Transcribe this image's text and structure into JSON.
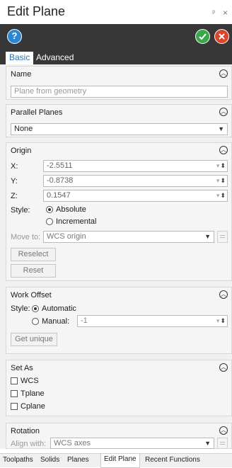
{
  "window": {
    "title": "Edit Plane",
    "pin_glyph": "ᵖ",
    "close_glyph": "×"
  },
  "toolbar": {
    "help_glyph": "?"
  },
  "tabs": {
    "basic": "Basic",
    "advanced": "Advanced"
  },
  "name_section": {
    "title": "Name",
    "placeholder": "Plane from geometry"
  },
  "parallel_section": {
    "title": "Parallel Planes",
    "selected": "None"
  },
  "origin_section": {
    "title": "Origin",
    "x_label": "X:",
    "x_value": "-2.5511",
    "y_label": "Y:",
    "y_value": "-0.8738",
    "z_label": "Z:",
    "z_value": "0.1547",
    "style_label": "Style:",
    "absolute": "Absolute",
    "absolute_selected": true,
    "incremental": "Incremental",
    "move_to_label": "Move to:",
    "move_to_value": "WCS origin",
    "reselect": "Reselect",
    "reset": "Reset"
  },
  "work_offset_section": {
    "title": "Work Offset",
    "style_label": "Style:",
    "automatic": "Automatic",
    "automatic_selected": true,
    "manual": "Manual:",
    "manual_value": "-1",
    "get_unique": "Get unique"
  },
  "set_as_section": {
    "title": "Set As",
    "wcs": "WCS",
    "tplane": "Tplane",
    "cplane": "Cplane"
  },
  "rotation_section": {
    "title": "Rotation",
    "align_label": "Align with:",
    "align_value": "WCS axes"
  },
  "bottom_tabs": [
    "Toolpaths",
    "Solids",
    "Planes",
    "Edit Plane",
    "Recent Functions"
  ],
  "colors": {
    "toolbar_bg": "#373737",
    "help": "#2a87d6",
    "ok": "#3aa84a",
    "cancel": "#d9472b",
    "active_tab_text": "#2a6fb6"
  },
  "icons": {
    "help": "question-circle-icon",
    "ok": "check-circle-icon",
    "cancel": "x-circle-icon",
    "collapse": "chevron-up-circle-icon"
  }
}
